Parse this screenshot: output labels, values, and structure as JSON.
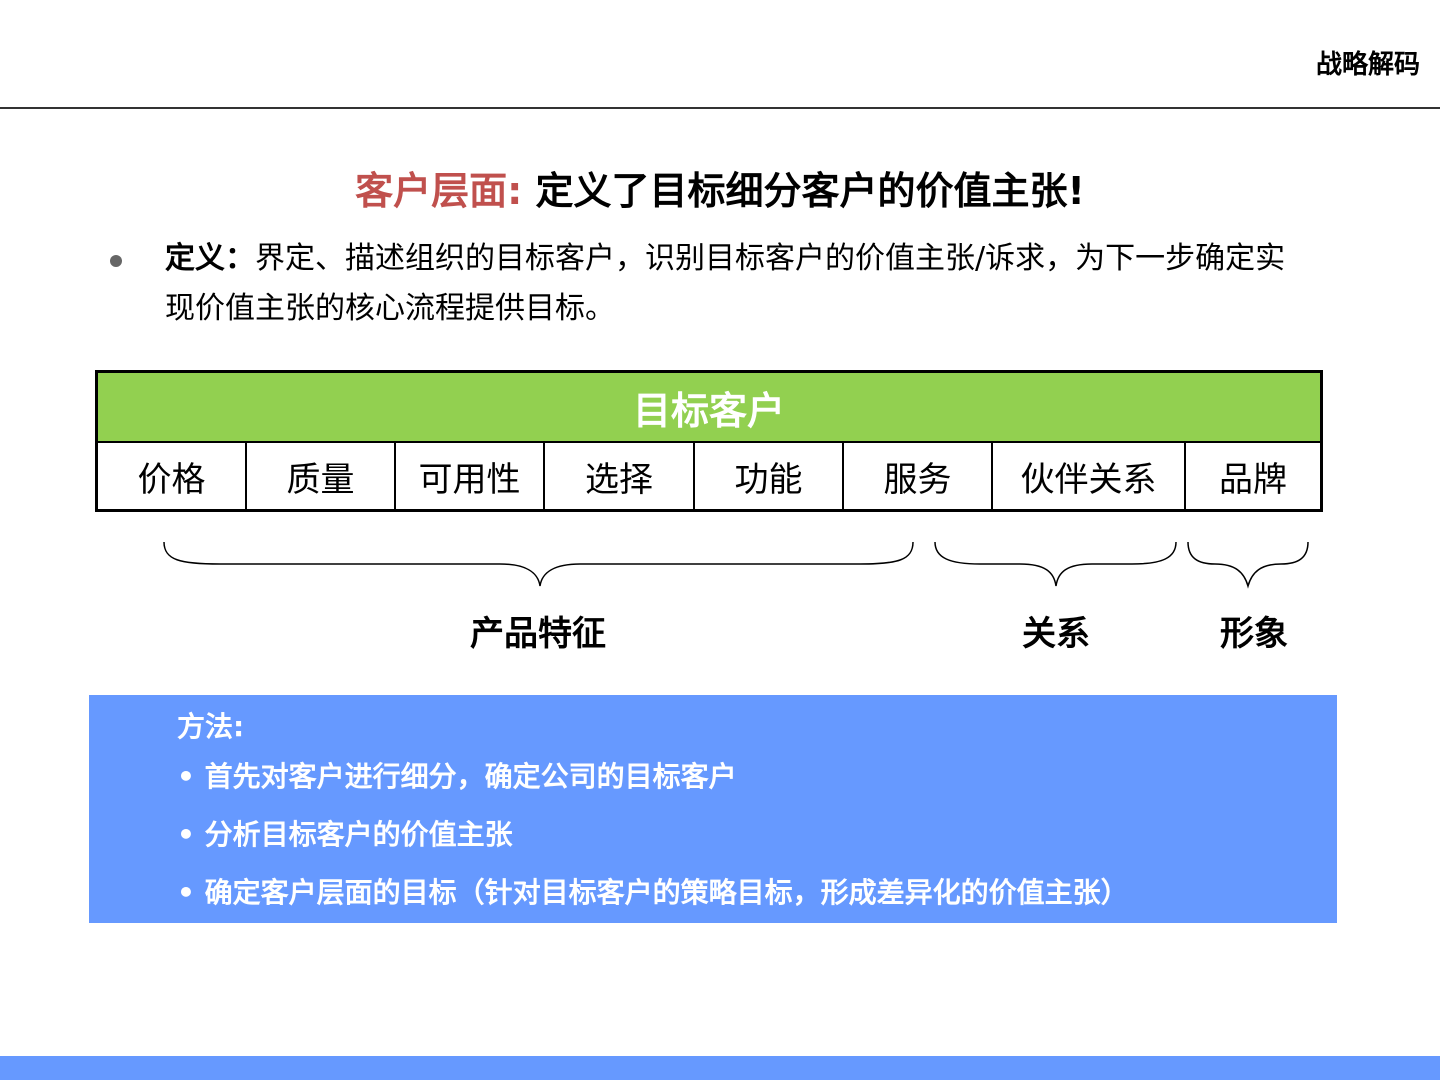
{
  "header": {
    "brand": "战略解码"
  },
  "title": {
    "prefix": "客户层面:",
    "main": " 定义了目标细分客户的价值主张!"
  },
  "definition": {
    "label": "定义：",
    "text": "界定、描述组织的目标客户，识别目标客户的价值主张/诉求，为下一步确定实现价值主张的核心流程提供目标。"
  },
  "table": {
    "header": "目标客户",
    "cells": [
      "价格",
      "质量",
      "可用性",
      "选择",
      "功能",
      "服务",
      "伙伴关系",
      "品牌"
    ]
  },
  "groups": {
    "product": "产品特征",
    "relation": "关系",
    "image": "形象"
  },
  "method": {
    "title": "方法:",
    "items": [
      "• 首先对客户进行细分，确定公司的目标客户",
      "• 分析目标客户的价值主张",
      "• 确定客户层面的目标（针对目标客户的策略目标，形成差异化的价值主张）"
    ]
  },
  "colors": {
    "accent_red": "#c0504d",
    "table_green": "#92d050",
    "method_blue": "#6699ff"
  }
}
